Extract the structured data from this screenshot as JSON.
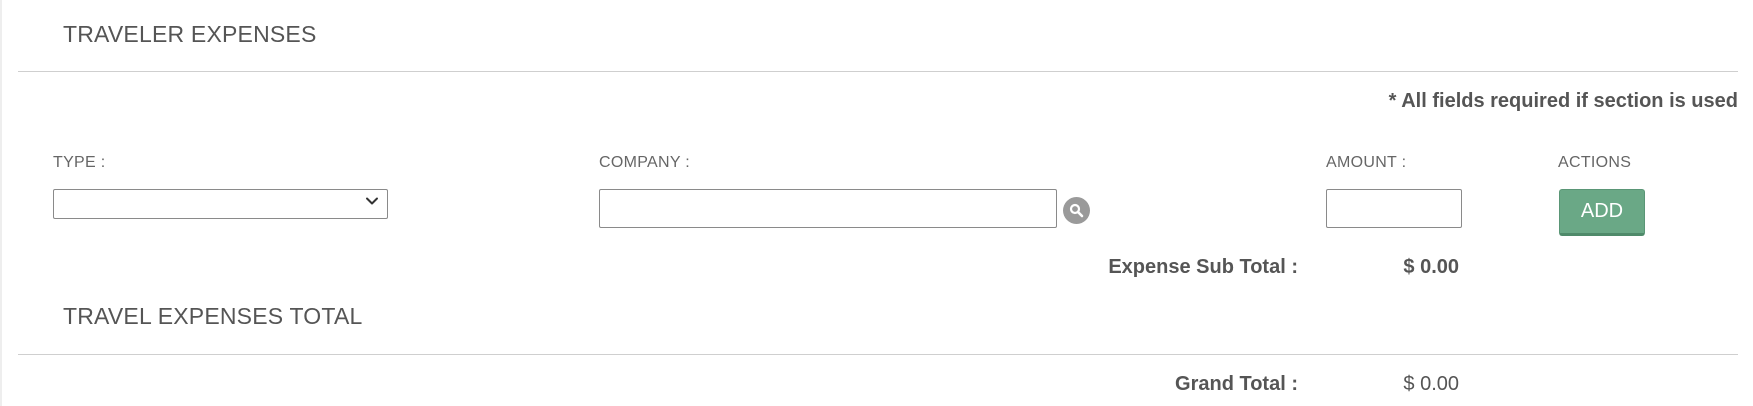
{
  "traveler_expenses": {
    "title": "TRAVELER EXPENSES",
    "required_note": "* All fields required if section is used",
    "fields": {
      "type": {
        "label": "TYPE :",
        "value": ""
      },
      "company": {
        "label": "COMPANY :",
        "value": "",
        "placeholder": ""
      },
      "amount": {
        "label": "AMOUNT :",
        "value": "",
        "placeholder": ""
      },
      "actions": {
        "label": "ACTIONS"
      }
    },
    "add_label": "ADD",
    "subtotal_label": "Expense Sub Total :",
    "subtotal_value": "$ 0.00"
  },
  "travel_expenses_total": {
    "title": "TRAVEL EXPENSES TOTAL",
    "grand_total_label": "Grand Total :",
    "grand_total_value": "$ 0.00"
  },
  "icons": {
    "select_arrow": "chevron-down-icon",
    "company_search": "search-icon"
  },
  "colors": {
    "add_button": "#6aa886",
    "search_button": "#9a9a9a",
    "text": "#555555"
  }
}
